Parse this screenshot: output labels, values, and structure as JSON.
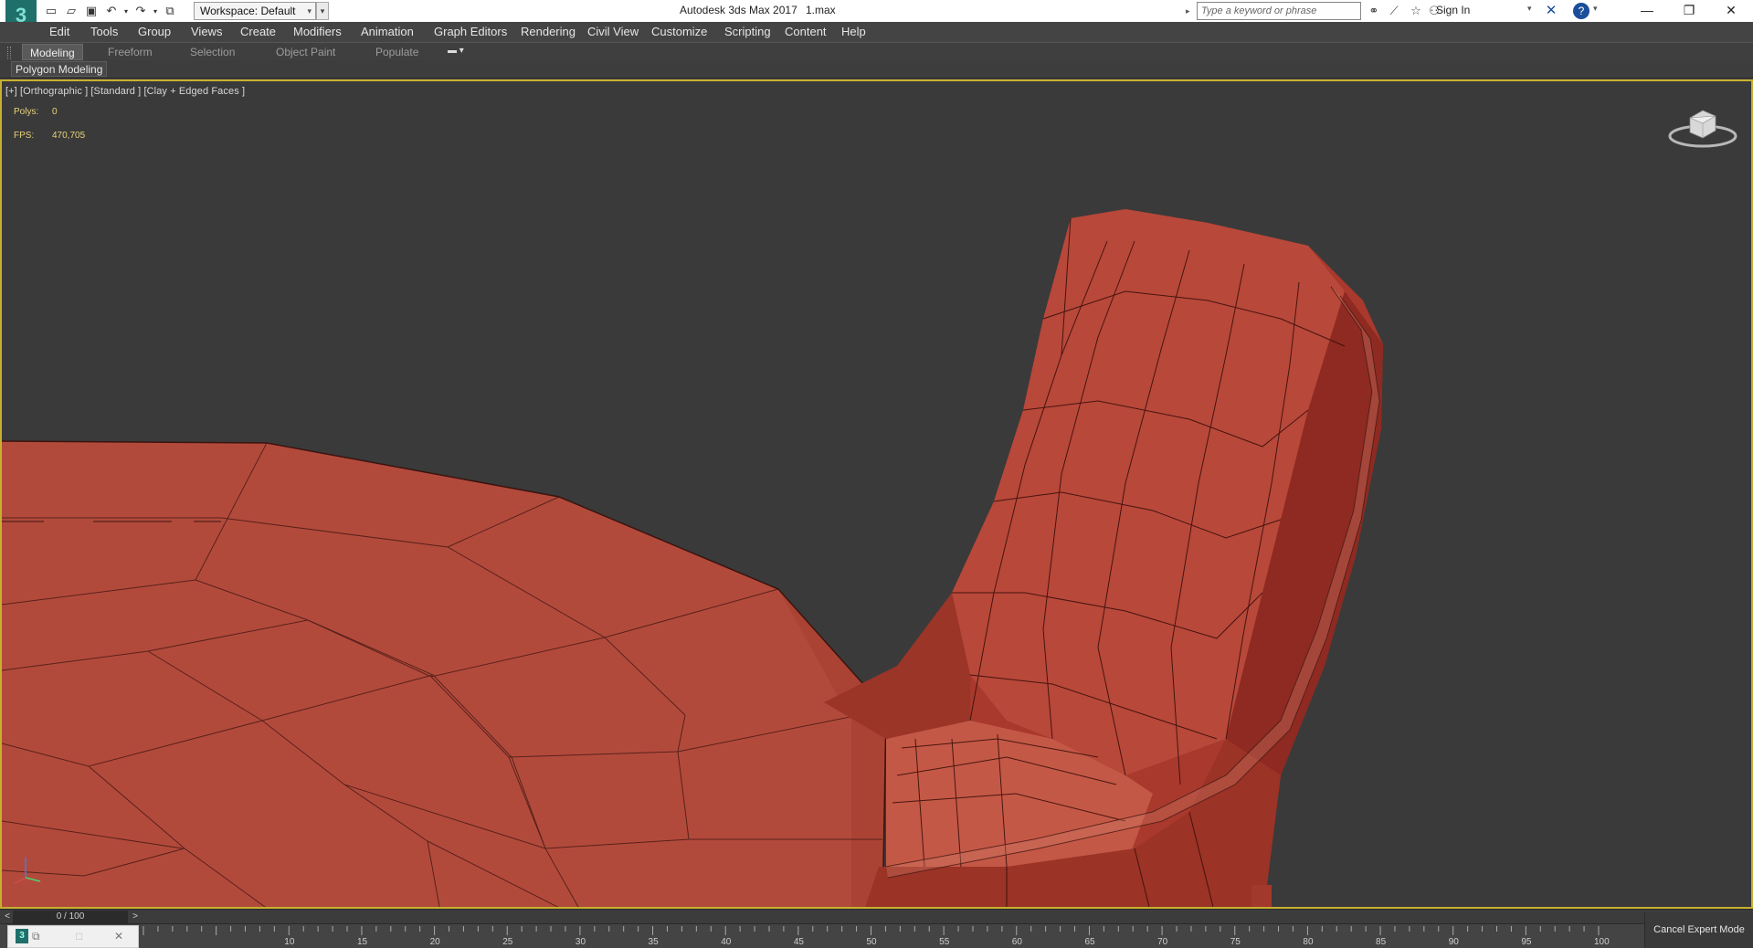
{
  "app": {
    "logo": "3",
    "title": "Autodesk 3ds Max 2017",
    "file": "1.max",
    "workspace": "Workspace: Default",
    "search_placeholder": "Type a keyword or phrase",
    "sign_in": "Sign In"
  },
  "menu": [
    "Edit",
    "Tools",
    "Group",
    "Views",
    "Create",
    "Modifiers",
    "Animation",
    "Graph Editors",
    "Rendering",
    "Civil View",
    "Customize",
    "Scripting",
    "Content",
    "Help"
  ],
  "ribbon": {
    "tabs": [
      "Modeling",
      "Freeform",
      "Selection",
      "Object Paint",
      "Populate"
    ],
    "active_tab": "Modeling",
    "panel_label": "Polygon Modeling"
  },
  "viewport": {
    "label": "[+] [Orthographic ] [Standard ] [Clay + Edged Faces ]",
    "stats": [
      {
        "name": "Polys:",
        "value": "0"
      },
      {
        "name": "FPS:",
        "value": "470,705"
      }
    ],
    "border_color": "#c8b02e",
    "mesh_color": "#b24a3c"
  },
  "timeline": {
    "frame_display": "0 / 100",
    "prev_arrow": "<",
    "next_arrow": ">",
    "ticks": [
      "10",
      "15",
      "20",
      "25",
      "30",
      "35",
      "40",
      "45",
      "50",
      "55",
      "60",
      "65",
      "70",
      "75",
      "80",
      "85",
      "90",
      "95",
      "100"
    ]
  },
  "status": {
    "cancel_expert_mode": "Cancel Expert Mode"
  },
  "icons": [
    "new-file-icon",
    "open-file-icon",
    "save-icon",
    "undo-icon",
    "redo-icon",
    "project-icon",
    "binoculars-icon",
    "communication-icon",
    "favorites-icon",
    "user-icon",
    "autodesk-x-icon",
    "help-icon",
    "viewcube-icon",
    "axis-tripod-icon"
  ]
}
